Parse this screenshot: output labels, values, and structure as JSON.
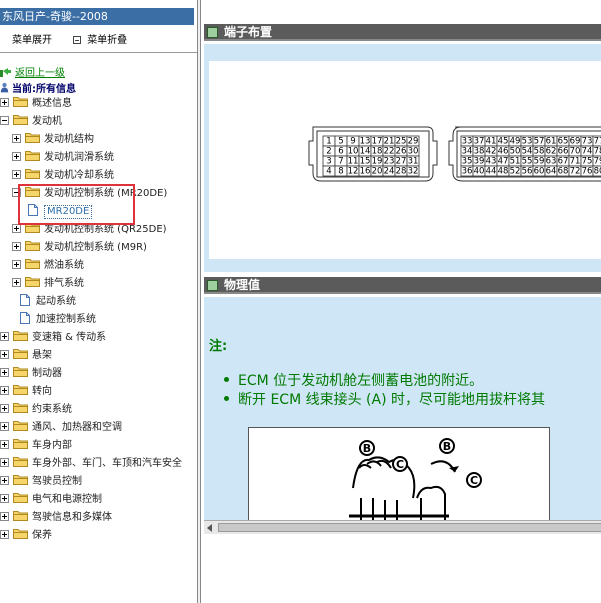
{
  "window": {
    "title": "东风日产-奇骏--2008"
  },
  "menu": {
    "expand_label": "菜单展开",
    "collapse_label": "菜单折叠"
  },
  "nav": {
    "back_label": "返回上一级",
    "current_label": "当前:所有信息"
  },
  "tree": {
    "items": [
      {
        "label": "概述信息",
        "type": "folder",
        "expander": "plus"
      },
      {
        "label": "发动机",
        "type": "folder",
        "expander": "minus"
      },
      {
        "label": "发动机结构",
        "type": "folder",
        "expander": "plus"
      },
      {
        "label": "发动机润滑系统",
        "type": "folder",
        "expander": "plus"
      },
      {
        "label": "发动机冷却系统",
        "type": "folder",
        "expander": "plus"
      },
      {
        "label": "发动机控制系统 (MR20DE)",
        "type": "folder",
        "expander": "minus"
      },
      {
        "label": "MR20DE",
        "type": "doc",
        "selected": true
      },
      {
        "label": "发动机控制系统 (QR25DE)",
        "type": "folder",
        "expander": "plus"
      },
      {
        "label": "发动机控制系统 (M9R)",
        "type": "folder",
        "expander": "plus"
      },
      {
        "label": "燃油系统",
        "type": "folder",
        "expander": "plus"
      },
      {
        "label": "排气系统",
        "type": "folder",
        "expander": "plus"
      },
      {
        "label": "起动系统",
        "type": "doc"
      },
      {
        "label": "加速控制系统",
        "type": "doc"
      },
      {
        "label": "变速箱 & 传动系",
        "type": "folder",
        "expander": "plus"
      },
      {
        "label": "悬架",
        "type": "folder",
        "expander": "plus"
      },
      {
        "label": "制动器",
        "type": "folder",
        "expander": "plus"
      },
      {
        "label": "转向",
        "type": "folder",
        "expander": "plus"
      },
      {
        "label": "约束系统",
        "type": "folder",
        "expander": "plus"
      },
      {
        "label": "通风、加热器和空调",
        "type": "folder",
        "expander": "plus"
      },
      {
        "label": "车身内部",
        "type": "folder",
        "expander": "plus"
      },
      {
        "label": "车身外部、车门、车顶和汽车安全",
        "type": "folder",
        "expander": "plus"
      },
      {
        "label": "驾驶员控制",
        "type": "folder",
        "expander": "plus"
      },
      {
        "label": "电气和电源控制",
        "type": "folder",
        "expander": "plus"
      },
      {
        "label": "驾驶信息和多媒体",
        "type": "folder",
        "expander": "plus"
      },
      {
        "label": "保养",
        "type": "folder",
        "expander": "plus"
      }
    ]
  },
  "content": {
    "section1_title": "端子布置",
    "section2_title": "物理值",
    "note_label": "注:",
    "bullets": [
      "ECM 位于发动机舱左侧蓄电池的附近。",
      "断开 ECM 线束接头 (A) 时，尽可能地用拔杆将其"
    ],
    "connector_left": [
      [
        "1",
        "5",
        "9",
        "13",
        "17",
        "21",
        "25",
        "29"
      ],
      [
        "2",
        "6",
        "10",
        "14",
        "18",
        "22",
        "26",
        "30"
      ],
      [
        "3",
        "7",
        "11",
        "15",
        "19",
        "23",
        "27",
        "31"
      ],
      [
        "4",
        "8",
        "12",
        "16",
        "20",
        "24",
        "28",
        "32"
      ]
    ],
    "connector_right": [
      [
        "33",
        "37",
        "41",
        "45",
        "49",
        "53",
        "57",
        "61",
        "65",
        "69",
        "73",
        "77"
      ],
      [
        "34",
        "38",
        "42",
        "46",
        "50",
        "54",
        "58",
        "62",
        "66",
        "70",
        "74",
        "78"
      ],
      [
        "35",
        "39",
        "43",
        "47",
        "51",
        "55",
        "59",
        "63",
        "67",
        "71",
        "75",
        "79"
      ],
      [
        "36",
        "40",
        "44",
        "48",
        "52",
        "56",
        "60",
        "64",
        "68",
        "72",
        "76",
        "80"
      ]
    ],
    "figure_callouts": [
      "B",
      "C",
      "B",
      "C"
    ]
  },
  "colors": {
    "title_bar": "#3a6ea5",
    "section_header": "#5b5b5b",
    "content_bg": "#cfe6f7",
    "note_green": "#007a00",
    "highlight_red": "#e0323a"
  }
}
